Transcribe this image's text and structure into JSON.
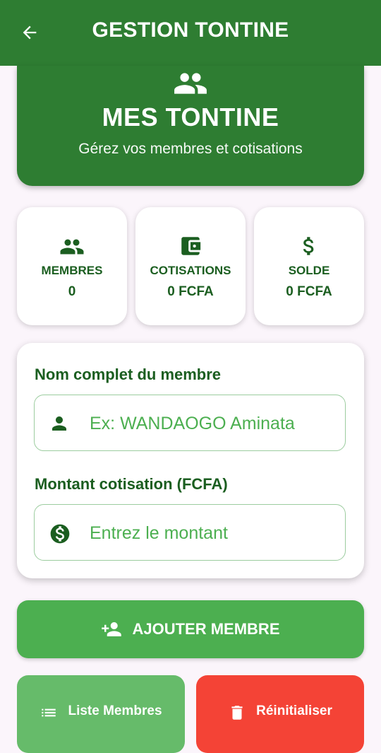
{
  "appbar": {
    "title": "GESTION TONTINE",
    "back_icon": "arrow-left-icon"
  },
  "hero": {
    "icon": "group-icon",
    "title": "MES TONTINE",
    "subtitle": "Gérez vos membres et cotisations"
  },
  "stats": [
    {
      "icon": "group-icon",
      "label": "MEMBRES",
      "value": "0"
    },
    {
      "icon": "wallet-icon",
      "label": "COTISATIONS",
      "value": "0 FCFA"
    },
    {
      "icon": "dollar-icon",
      "label": "SOLDE",
      "value": "0 FCFA"
    }
  ],
  "form": {
    "name_label": "Nom complet du membre",
    "name_placeholder": "Ex: WANDAOGO Aminata",
    "name_value": "",
    "amount_label": "Montant cotisation (FCFA)",
    "amount_placeholder": "Entrez le montant",
    "amount_value": ""
  },
  "buttons": {
    "add": "AJOUTER MEMBRE",
    "list": "Liste Membres",
    "reset": "Réinitialiser"
  },
  "colors": {
    "primary_dark": "#2e7d32",
    "primary": "#4caf50",
    "primary_light": "#66bb6a",
    "danger": "#f44336",
    "text_green": "#1b5e20",
    "background": "#fbf5fb"
  }
}
